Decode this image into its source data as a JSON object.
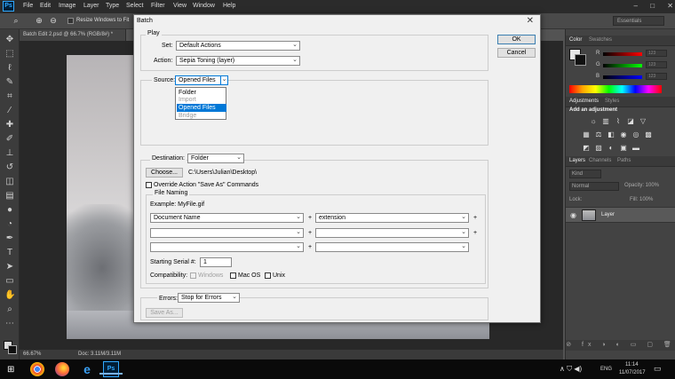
{
  "app": {
    "logo": "Ps",
    "menu": [
      "File",
      "Edit",
      "Image",
      "Layer",
      "Type",
      "Select",
      "Filter",
      "View",
      "Window",
      "Help"
    ],
    "window_controls": [
      "–",
      "□",
      "✕"
    ]
  },
  "options_bar": {
    "resize_label": "Resize Windows to Fit",
    "workspace": "Essentials"
  },
  "document": {
    "tab_title": "Batch Edit 2.psd @ 66.7% (RGB/8#) *",
    "zoom": "66.67%",
    "doc_size": "Doc: 3.11M/3.11M"
  },
  "panels": {
    "color_tabs": [
      "Color",
      "Swatches"
    ],
    "sliders": [
      {
        "label": "R",
        "value": "123"
      },
      {
        "label": "G",
        "value": "123"
      },
      {
        "label": "B",
        "value": "123"
      }
    ],
    "adjust_tabs": [
      "Adjustments",
      "Styles"
    ],
    "add_adjustment": "Add an adjustment",
    "layers_tabs": [
      "Layers",
      "Channels",
      "Paths"
    ],
    "kind": "Kind",
    "blend_mode": "Normal",
    "opacity": "Opacity: 100%",
    "lock": "Lock:",
    "fill": "Fill: 100%",
    "layer_name": "Layer"
  },
  "dialog": {
    "title": "Batch",
    "close": "✕",
    "play": {
      "legend": "Play",
      "set_label": "Set:",
      "set_value": "Default Actions",
      "action_label": "Action:",
      "action_value": "Sepia Toning (layer)"
    },
    "source": {
      "label": "Source:",
      "value": "Opened Files",
      "options": [
        {
          "label": "Folder",
          "state": "normal"
        },
        {
          "label": "Import",
          "state": "disabled"
        },
        {
          "label": "Opened Files",
          "state": "selected"
        },
        {
          "label": "Bridge",
          "state": "disabled"
        }
      ]
    },
    "destination": {
      "label": "Destination:",
      "value": "Folder",
      "choose_button": "Choose...",
      "path": "C:\\Users\\Julian\\Desktop\\",
      "override_label": "Override Action \"Save As\" Commands"
    },
    "file_naming": {
      "legend": "File Naming",
      "example": "Example: MyFile.gif",
      "rows": [
        [
          "Document Name",
          "extension"
        ],
        [
          "",
          ""
        ],
        [
          "",
          ""
        ]
      ],
      "serial_label": "Starting Serial #:",
      "serial_value": "1",
      "compat_label": "Compatibility:",
      "compat_windows": "Windows",
      "compat_mac": "Mac OS",
      "compat_unix": "Unix"
    },
    "errors": {
      "label": "Errors:",
      "value": "Stop for Errors",
      "save_as": "Save As..."
    },
    "ok": "OK",
    "cancel": "Cancel"
  },
  "taskbar": {
    "start": "⊞",
    "ps_label": "Ps",
    "tray": "∧ ⛉ ◀)",
    "lang": "ENG",
    "time": "11:14",
    "date": "11/07/2017"
  }
}
